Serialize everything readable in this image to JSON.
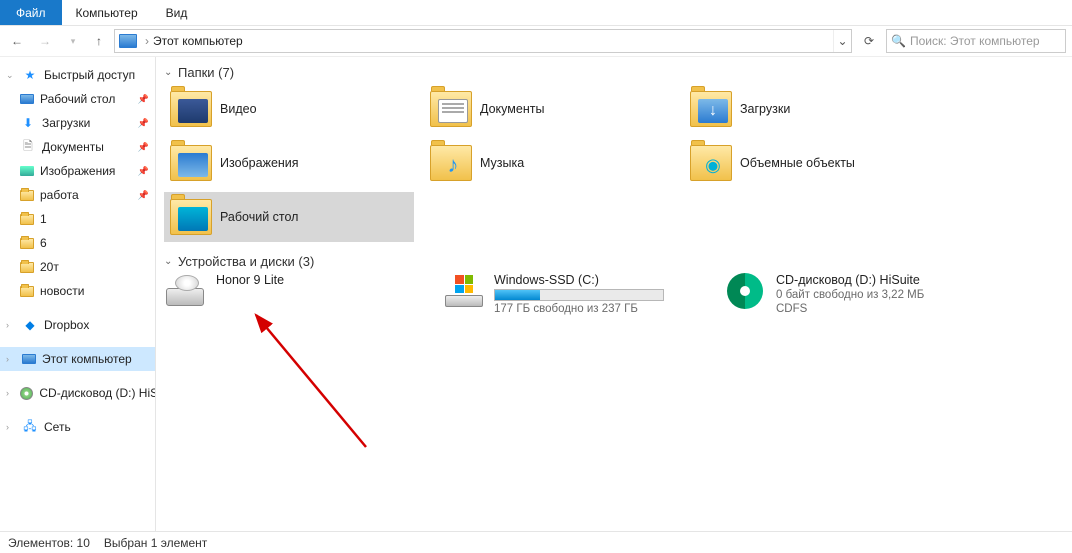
{
  "ribbon": {
    "file": "Файл",
    "computer": "Компьютер",
    "view": "Вид"
  },
  "nav": {
    "address_caret": "›",
    "address": "Этот компьютер"
  },
  "search": {
    "placeholder": "Поиск: Этот компьютер"
  },
  "sidebar": {
    "quick": "Быстрый доступ",
    "pinned": [
      {
        "label": "Рабочий стол"
      },
      {
        "label": "Загрузки"
      },
      {
        "label": "Документы"
      },
      {
        "label": "Изображения"
      },
      {
        "label": "работа"
      }
    ],
    "unpinned": [
      {
        "label": "1"
      },
      {
        "label": "6"
      },
      {
        "label": "20т"
      },
      {
        "label": "новости"
      }
    ],
    "dropbox": "Dropbox",
    "thispc": "Этот компьютер",
    "cd": "CD-дисковод (D:) HiSuite",
    "network": "Сеть"
  },
  "groups": {
    "folders_title": "Папки (7)",
    "drives_title": "Устройства и диски (3)"
  },
  "folders": [
    {
      "label": "Видео",
      "kind": "video"
    },
    {
      "label": "Документы",
      "kind": "doc"
    },
    {
      "label": "Загрузки",
      "kind": "down"
    },
    {
      "label": "Изображения",
      "kind": "img"
    },
    {
      "label": "Музыка",
      "kind": "music"
    },
    {
      "label": "Объемные объекты",
      "kind": "3d"
    },
    {
      "label": "Рабочий стол",
      "kind": "desk",
      "selected": true
    }
  ],
  "drives": [
    {
      "name": "Honor 9 Lite",
      "kind": "device"
    },
    {
      "name": "Windows-SSD (C:)",
      "kind": "ssd",
      "free_text": "177 ГБ свободно из 237 ГБ",
      "fill_pct": 27
    },
    {
      "name": "CD-дисковод (D:) HiSuite",
      "kind": "cd",
      "free_text": "0 байт свободно из 3,22 МБ",
      "fs": "CDFS"
    }
  ],
  "status": {
    "items": "Элементов: 10",
    "selected": "Выбран 1 элемент"
  }
}
